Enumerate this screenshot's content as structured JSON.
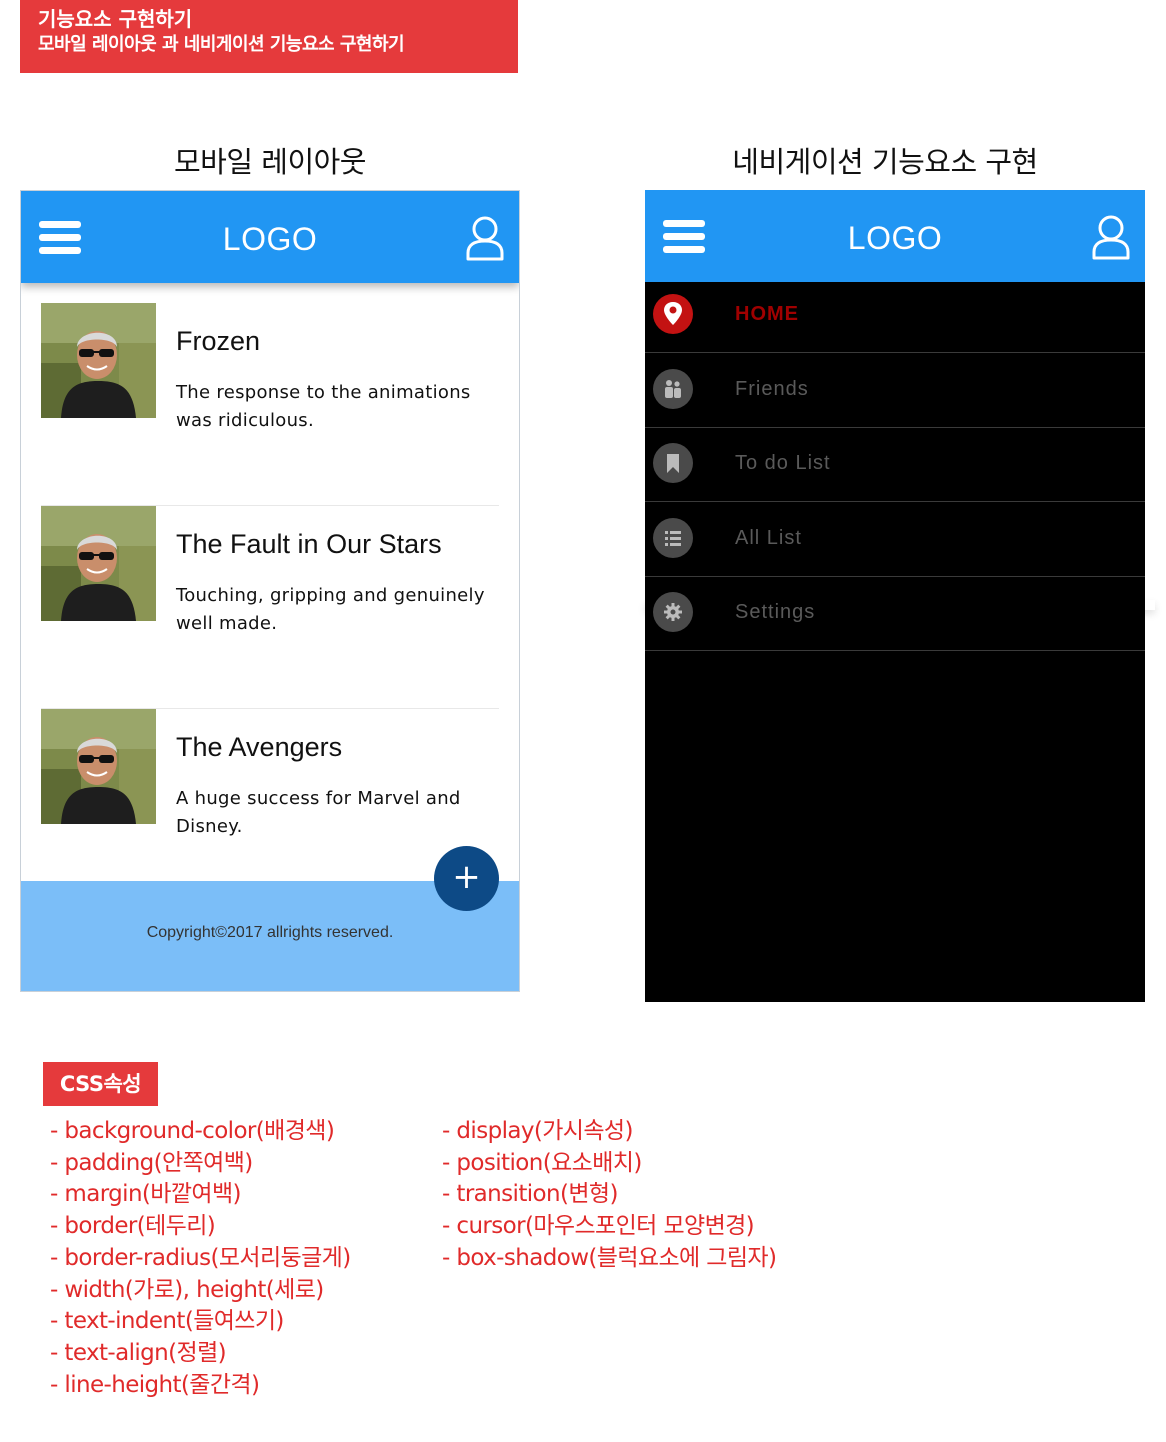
{
  "banner": {
    "line1": "기능요소 구현하기",
    "line2": "모바일 레이아웃 과 네비게이션 기능요소 구현하기"
  },
  "sections": {
    "left_title": "모바일 레이아웃",
    "right_title": "네비게이션 기능요소 구현"
  },
  "colors": {
    "appbar": "#2196f3",
    "footer": "#7bbef8",
    "fab": "#0d4a86",
    "banner": "#e53a3c",
    "drawer": "#000000",
    "active": "#a00000"
  },
  "appbar": {
    "logo": "LOGO",
    "menu_icon": "hamburger-menu-icon",
    "user_icon": "user-outline-icon"
  },
  "list": [
    {
      "title": "Frozen",
      "desc": "The response to the animations was ridiculous."
    },
    {
      "title": "The Fault in Our Stars",
      "desc": "Touching, gripping and genuinely well made."
    },
    {
      "title": "The Avengers",
      "desc": "A huge success for Marvel and Disney."
    }
  ],
  "fab": {
    "label": "+"
  },
  "footer": {
    "text": "Copyright©2017 allrights reserved."
  },
  "nav": [
    {
      "label": "HOME",
      "icon": "map-pin-icon",
      "active": true
    },
    {
      "label": "Friends",
      "icon": "people-icon",
      "active": false
    },
    {
      "label": "To do List",
      "icon": "bookmark-icon",
      "active": false
    },
    {
      "label": "All List",
      "icon": "list-icon",
      "active": false
    },
    {
      "label": "Settings",
      "icon": "gear-icon",
      "active": false
    }
  ],
  "css_props": {
    "badge": "CSS속성",
    "col1": [
      "- background-color(배경색)",
      "- padding(안쪽여백)",
      "- margin(바깥여백)",
      "- border(테두리)",
      "- border-radius(모서리둥글게)",
      "- width(가로), height(세로)",
      "- text-indent(들여쓰기)",
      "- text-align(정렬)",
      "- line-height(줄간격)"
    ],
    "col2": [
      "- display(가시속성)",
      "- position(요소배치)",
      "- transition(변형)",
      "- cursor(마우스포인터 모양변경)",
      "- box-shadow(블럭요소에 그림자)"
    ]
  }
}
